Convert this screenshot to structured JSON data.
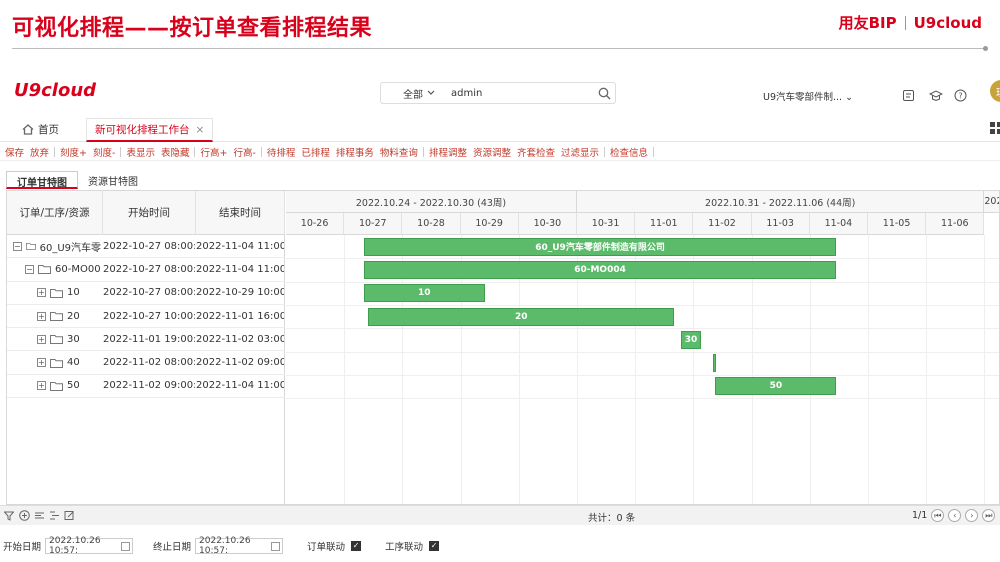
{
  "slide": {
    "title": "可视化排程——按订单查看排程结果",
    "brand_left": "用友BIP",
    "brand_right": "U9cloud"
  },
  "app": {
    "logo": "U9cloud",
    "search_scope": "全部",
    "search_value": "admin",
    "org": "U9汽车零部件制...",
    "avatar": "理"
  },
  "tabs": {
    "home": "首页",
    "workbench": "新可视化排程工作台",
    "close": "×"
  },
  "toolbar": [
    "保存",
    "放弃",
    "刻度+",
    "刻度-",
    "表显示",
    "表隐藏",
    "行高+",
    "行高-",
    "待排程",
    "已排程",
    "排程事务",
    "物料查询",
    "排程调整",
    "资源调整",
    "齐套检查",
    "过滤显示",
    "检查信息"
  ],
  "view_tabs": [
    "订单甘特图",
    "资源甘特图"
  ],
  "gantt": {
    "headers": {
      "name": "订单/工序/资源",
      "start": "开始时间",
      "end": "结束时间"
    },
    "weeks": [
      "2022.10.24 - 2022.10.30 (43周)",
      "2022.10.31 - 2022.11.06 (44周)",
      "202"
    ],
    "days": [
      "10-26",
      "10-27",
      "10-28",
      "10-29",
      "10-30",
      "10-31",
      "11-01",
      "11-02",
      "11-03",
      "11-04",
      "11-05",
      "11-06"
    ],
    "rows": [
      {
        "name": "60_U9汽车零",
        "start": "2022-10-27 08:00:0",
        "end": "2022-11-04 11:00:0",
        "bar_label": "60_U9汽车零部件制造有限公司"
      },
      {
        "name": "60-MO00",
        "start": "2022-10-27 08:00:0",
        "end": "2022-11-04 11:00:0",
        "bar_label": "60-MO004"
      },
      {
        "name": "10",
        "start": "2022-10-27 08:00:0",
        "end": "2022-10-29 10:00:0",
        "bar_label": "10"
      },
      {
        "name": "20",
        "start": "2022-10-27 10:00:0",
        "end": "2022-11-01 16:00:0",
        "bar_label": "20"
      },
      {
        "name": "30",
        "start": "2022-11-01 19:00:0",
        "end": "2022-11-02 03:00:0",
        "bar_label": "30"
      },
      {
        "name": "40",
        "start": "2022-11-02 08:00:0",
        "end": "2022-11-02 09:00:0",
        "bar_label": ""
      },
      {
        "name": "50",
        "start": "2022-11-02 09:00:0",
        "end": "2022-11-04 11:00:0",
        "bar_label": "50"
      }
    ]
  },
  "footer": {
    "total": "共计：0 条",
    "page": "1/1"
  },
  "filters": {
    "start_label": "开始日期",
    "start_value": "2022.10.26 10:57:",
    "end_label": "终止日期",
    "end_value": "2022.10.26 10:57:",
    "order_link_label": "订单联动",
    "process_link_label": "工序联动"
  },
  "colors": {
    "accent": "#d9001b",
    "bar": "#5cbb6a"
  }
}
